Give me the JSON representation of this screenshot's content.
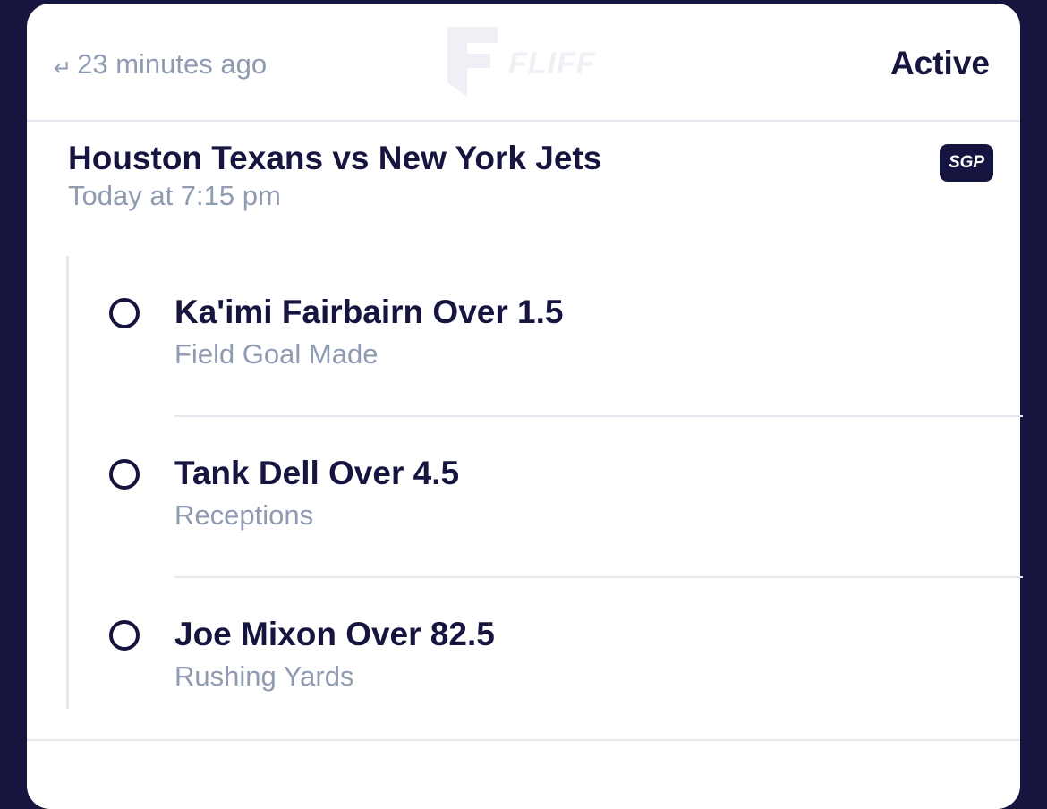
{
  "header": {
    "time_ago": "23 minutes ago",
    "watermark_text": "FLIFF",
    "status": "Active"
  },
  "game": {
    "title": "Houston Texans vs New York Jets",
    "time": "Today at 7:15 pm",
    "badge": "SGP"
  },
  "legs": [
    {
      "title": "Ka'imi Fairbairn Over 1.5",
      "market": "Field Goal Made"
    },
    {
      "title": "Tank Dell Over 4.5",
      "market": "Receptions"
    },
    {
      "title": "Joe Mixon Over 82.5",
      "market": "Rushing Yards"
    }
  ],
  "colors": {
    "background": "#161540",
    "card": "#ffffff",
    "primary_text": "#161540",
    "secondary_text": "#8f9bb0",
    "divider": "#e4e7ee"
  }
}
